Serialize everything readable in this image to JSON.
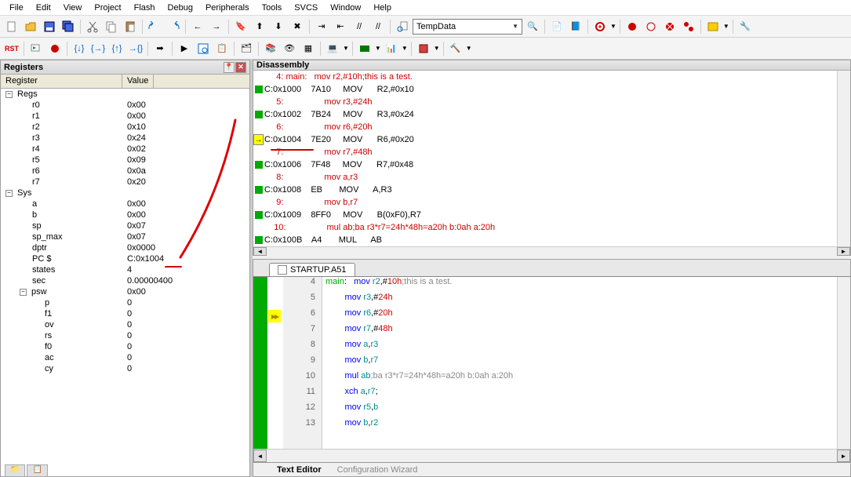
{
  "menu": [
    "File",
    "Edit",
    "View",
    "Project",
    "Flash",
    "Debug",
    "Peripherals",
    "Tools",
    "SVCS",
    "Window",
    "Help"
  ],
  "combo1": "TempData",
  "registers_panel": {
    "title": "Registers",
    "header": {
      "col1": "Register",
      "col2": "Value"
    },
    "groups": [
      {
        "name": "Regs",
        "expanded": true,
        "items": [
          {
            "name": "r0",
            "value": "0x00"
          },
          {
            "name": "r1",
            "value": "0x00"
          },
          {
            "name": "r2",
            "value": "0x10"
          },
          {
            "name": "r3",
            "value": "0x24"
          },
          {
            "name": "r4",
            "value": "0x02"
          },
          {
            "name": "r5",
            "value": "0x09"
          },
          {
            "name": "r6",
            "value": "0x0a"
          },
          {
            "name": "r7",
            "value": "0x20"
          }
        ]
      },
      {
        "name": "Sys",
        "expanded": true,
        "items": [
          {
            "name": "a",
            "value": "0x00"
          },
          {
            "name": "b",
            "value": "0x00"
          },
          {
            "name": "sp",
            "value": "0x07"
          },
          {
            "name": "sp_max",
            "value": "0x07"
          },
          {
            "name": "dptr",
            "value": "0x0000"
          },
          {
            "name": "PC  $",
            "value": "C:0x1004"
          },
          {
            "name": "states",
            "value": "4"
          },
          {
            "name": "sec",
            "value": "0.00000400"
          }
        ],
        "sub": {
          "name": "psw",
          "value": "0x00",
          "expanded": true,
          "items": [
            {
              "name": "p",
              "value": "0"
            },
            {
              "name": "f1",
              "value": "0"
            },
            {
              "name": "ov",
              "value": "0"
            },
            {
              "name": "rs",
              "value": "0"
            },
            {
              "name": "f0",
              "value": "0"
            },
            {
              "name": "ac",
              "value": "0"
            },
            {
              "name": "cy",
              "value": "0"
            }
          ]
        }
      }
    ]
  },
  "disassembly": {
    "title": "Disassembly",
    "lines": [
      {
        "marker": "",
        "src": true,
        "text": "     4: main:   mov r2,#10h;this is a test."
      },
      {
        "marker": "g",
        "text": "C:0x1000    7A10     MOV      R2,#0x10"
      },
      {
        "marker": "",
        "src": true,
        "text": "     5:                 mov r3,#24h"
      },
      {
        "marker": "g",
        "text": "C:0x1002    7B24     MOV      R3,#0x24"
      },
      {
        "marker": "",
        "src": true,
        "text": "     6:                 mov r6,#20h"
      },
      {
        "marker": "y",
        "text": "C:0x1004    7E20     MOV      R6,#0x20"
      },
      {
        "marker": "",
        "src": true,
        "text": "     7:                 mov r7,#48h"
      },
      {
        "marker": "g",
        "text": "C:0x1006    7F48     MOV      R7,#0x48"
      },
      {
        "marker": "",
        "src": true,
        "text": "     8:                 mov a,r3"
      },
      {
        "marker": "g",
        "text": "C:0x1008    EB       MOV      A,R3"
      },
      {
        "marker": "",
        "src": true,
        "text": "     9:                 mov b,r7"
      },
      {
        "marker": "g",
        "text": "C:0x1009    8FF0     MOV      B(0xF0),R7"
      },
      {
        "marker": "",
        "src": true,
        "text": "    10:                 mul ab;ba r3*r7=24h*48h=a20h b:0ah a:20h"
      },
      {
        "marker": "g",
        "text": "C:0x100B    A4       MUL      AB"
      }
    ]
  },
  "editor": {
    "tab": "STARTUP.A51",
    "first_line": 4,
    "bottom_tabs": [
      "Text Editor",
      "Configuration Wizard"
    ],
    "lines": [
      {
        "n": 4,
        "html": "<span class='lbl'>main</span>:   <span class='kw'>mov</span> <span class='reg'>r2</span>,#<span class='num'>10h</span><span class='cmt'>;this is a test.</span>"
      },
      {
        "n": 5,
        "html": "        <span class='kw'>mov</span> <span class='reg'>r3</span>,#<span class='num'>24h</span>"
      },
      {
        "n": 6,
        "html": "        <span class='kw'>mov</span> <span class='reg'>r6</span>,#<span class='num'>20h</span>"
      },
      {
        "n": 7,
        "html": "        <span class='kw'>mov</span> <span class='reg'>r7</span>,#<span class='num'>48h</span>"
      },
      {
        "n": 8,
        "html": "        <span class='kw'>mov</span> <span class='reg'>a</span>,<span class='reg'>r3</span>"
      },
      {
        "n": 9,
        "html": "        <span class='kw'>mov</span> <span class='reg'>b</span>,<span class='reg'>r7</span>"
      },
      {
        "n": 10,
        "html": "        <span class='kw'>mul</span> <span class='reg'>ab</span><span class='cmt'>;ba r3*r7=24h*48h=a20h b:0ah a:20h</span>"
      },
      {
        "n": 11,
        "html": "        <span class='kw'>xch</span> <span class='reg'>a</span>,<span class='reg'>r7</span>;"
      },
      {
        "n": 12,
        "html": "        <span class='kw'>mov</span> <span class='reg'>r5</span>,<span class='reg'>b</span>"
      },
      {
        "n": 13,
        "html": "        <span class='kw'>mov</span> <span class='reg'>b</span>,<span class='reg'>r2</span>"
      }
    ]
  }
}
